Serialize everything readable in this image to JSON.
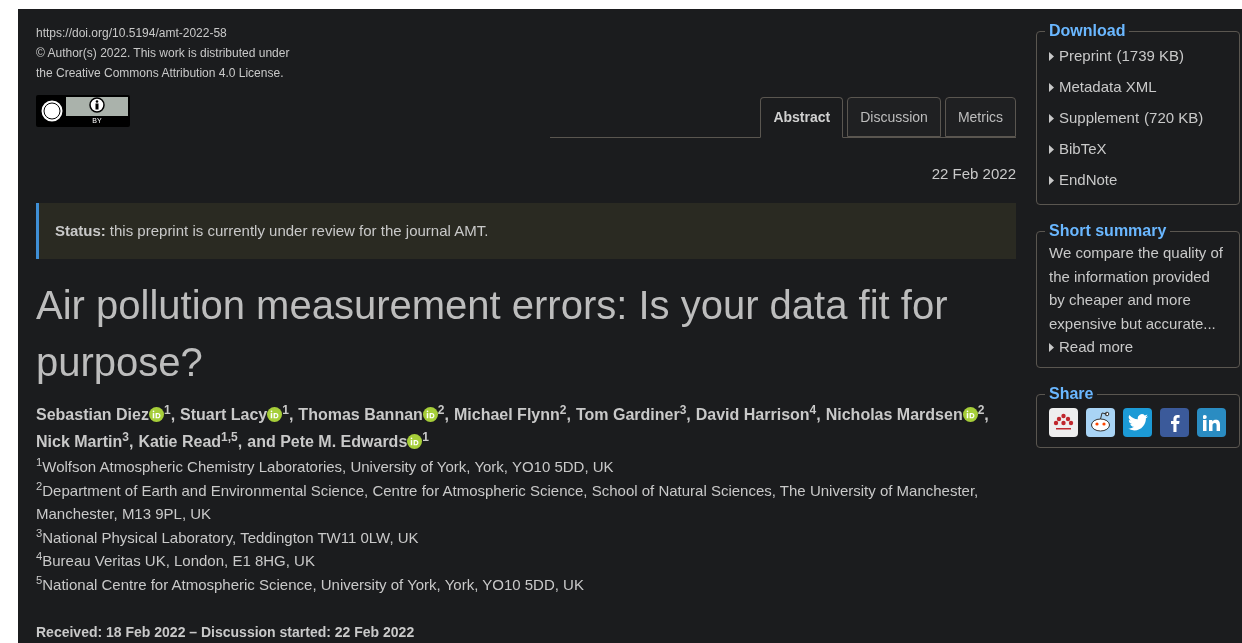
{
  "header": {
    "doi": "https://doi.org/10.5194/amt-2022-58",
    "license_lines": [
      "© Author(s) 2022. This work is distributed under",
      "the Creative Commons Attribution 4.0 License."
    ],
    "badge_label": "BY"
  },
  "tabs": [
    {
      "label": "Abstract",
      "selected": true
    },
    {
      "label": "Discussion",
      "selected": false
    },
    {
      "label": "Metrics",
      "selected": false
    }
  ],
  "date": "22 Feb 2022",
  "status": {
    "label": "Status:",
    "text": "this preprint is currently under review for the journal AMT."
  },
  "title": "Air pollution measurement errors: Is your data fit for purpose?",
  "authors": [
    {
      "name": "Sebastian Diez",
      "orcid": true,
      "sup": "$^{1}$,"
    },
    {
      "name": "Stuart Lacy",
      "orcid": true,
      "sup": "$^{1}$,"
    },
    {
      "name": "Thomas Bannan",
      "orcid": true,
      "sup": "$^{2}$,"
    },
    {
      "name": "Michael Flynn",
      "orcid": false,
      "sup": "$^{2}$,"
    },
    {
      "name": "Tom Gardiner",
      "orcid": false,
      "sup": "$^{3}$,"
    },
    {
      "name": "David Harrison",
      "orcid": false,
      "sup": "$^{4}$,"
    },
    {
      "name": "Nicholas Mardsen",
      "orcid": true,
      "sup": "$^{2}$,"
    },
    {
      "name": "Nick Martin",
      "orcid": false,
      "sup": "$^{3}$,"
    },
    {
      "name": "Katie Read",
      "orcid": false,
      "sup": "$^{1,5}$,"
    },
    {
      "name": "and Pete M. Edwards",
      "orcid": true,
      "sup": "$^{1}$"
    }
  ],
  "affiliations": [
    "$^{1}$Wolfson Atmospheric Chemistry Laboratories, University of York, York, YO10 5DD, UK",
    "$^{2}$Department of Earth and Environmental Science, Centre for Atmospheric Science, School of Natural Sciences, The University of Manchester, Manchester, M13 9PL, UK",
    "$^{3}$National Physical Laboratory, Teddington TW11 0LW, UK",
    "$^{4}$Bureau Veritas UK, London, E1 8HG, UK",
    "$^{5}$National Centre for Atmospheric Science, University of York, York, YO10 5DD, UK"
  ],
  "history": "Received: 18 Feb 2022 – Discussion started: 22 Feb 2022",
  "download": {
    "title": "Download",
    "items": [
      {
        "label": "Preprint",
        "size": "(1739 KB)"
      },
      {
        "label": "Metadata XML"
      },
      {
        "label": "Supplement",
        "size": "(720 KB)"
      },
      {
        "label": "BibTeX"
      },
      {
        "label": "EndNote"
      }
    ]
  },
  "summary": {
    "title": "Short summary",
    "text": "We compare the quality of the information provided by cheaper and more expensive but accurate...",
    "link": "Read more"
  },
  "share": {
    "title": "Share",
    "items": [
      {
        "kind": "mendeley"
      },
      {
        "kind": "reddit"
      },
      {
        "kind": "twitter"
      },
      {
        "kind": "facebook"
      },
      {
        "kind": "linkedin"
      }
    ]
  }
}
